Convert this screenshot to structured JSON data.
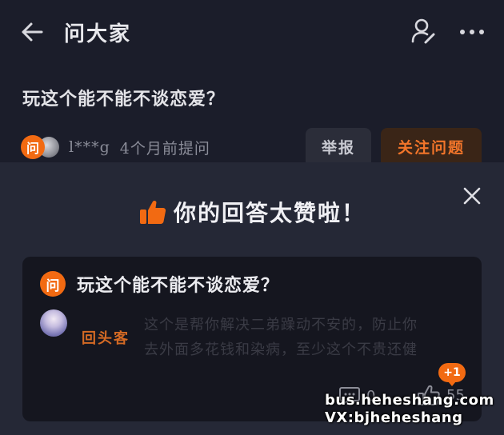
{
  "header": {
    "title": "问大家",
    "back_icon": "arrow-left-icon",
    "user_icon": "user-edit-icon",
    "more_icon": "more-dots-icon"
  },
  "question": {
    "title": "玩这个能不能不谈恋爱？",
    "badge": "问",
    "asker_name": "l***g",
    "asked_time": "4个月前提问",
    "report_label": "举报",
    "follow_label": "关注问题"
  },
  "sheet": {
    "title": "你的回答太赞啦！",
    "close_icon": "close-icon",
    "thumb_icon": "thumbs-up-icon"
  },
  "answer_card": {
    "badge": "问",
    "question_title": "玩这个能不能不谈恋爱？",
    "author": "回头客",
    "excerpt": "这个是帮你解决二弟躁动不安的，防止你\n去外面多花钱和染病，至少这个不贵还健",
    "plus_badge": "+1",
    "comment_count": "0",
    "like_count": "55"
  },
  "watermark": {
    "line1": "bus.heheshang.com",
    "line2": "VX:bjheheshang"
  },
  "colors": {
    "accent": "#f26a12",
    "background": "#1b1d2a",
    "sheet": "#252836",
    "card": "#15161f"
  }
}
